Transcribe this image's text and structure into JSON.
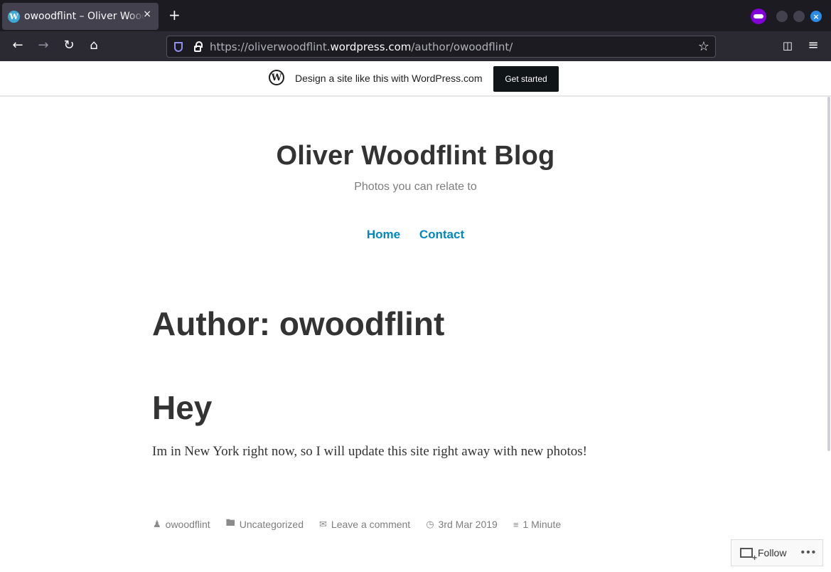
{
  "browser": {
    "tab_title": "owoodflint – Oliver Woodflint Blog",
    "tab_close": "×",
    "new_tab": "+",
    "url_prefix": "https://oliverwoodflint.",
    "url_domain": "wordpress.com",
    "url_path": "/author/owoodflint/",
    "window_close": "×"
  },
  "banner": {
    "text": "Design a site like this with WordPress.com",
    "button": "Get started"
  },
  "site": {
    "title": "Oliver Woodflint Blog",
    "tagline": "Photos you can relate to",
    "menu": [
      "Home",
      "Contact"
    ]
  },
  "archive": {
    "title": "Author: owoodflint"
  },
  "post": {
    "title": "Hey",
    "content": "Im in New York right now, so I will update this site right away with new photos!",
    "meta": {
      "author": "owoodflint",
      "category": "Uncategorized",
      "comments": "Leave a comment",
      "date": "3rd Mar 2019",
      "reading_time": "1 Minute"
    }
  },
  "follow": {
    "label": "Follow",
    "more": "•••"
  }
}
